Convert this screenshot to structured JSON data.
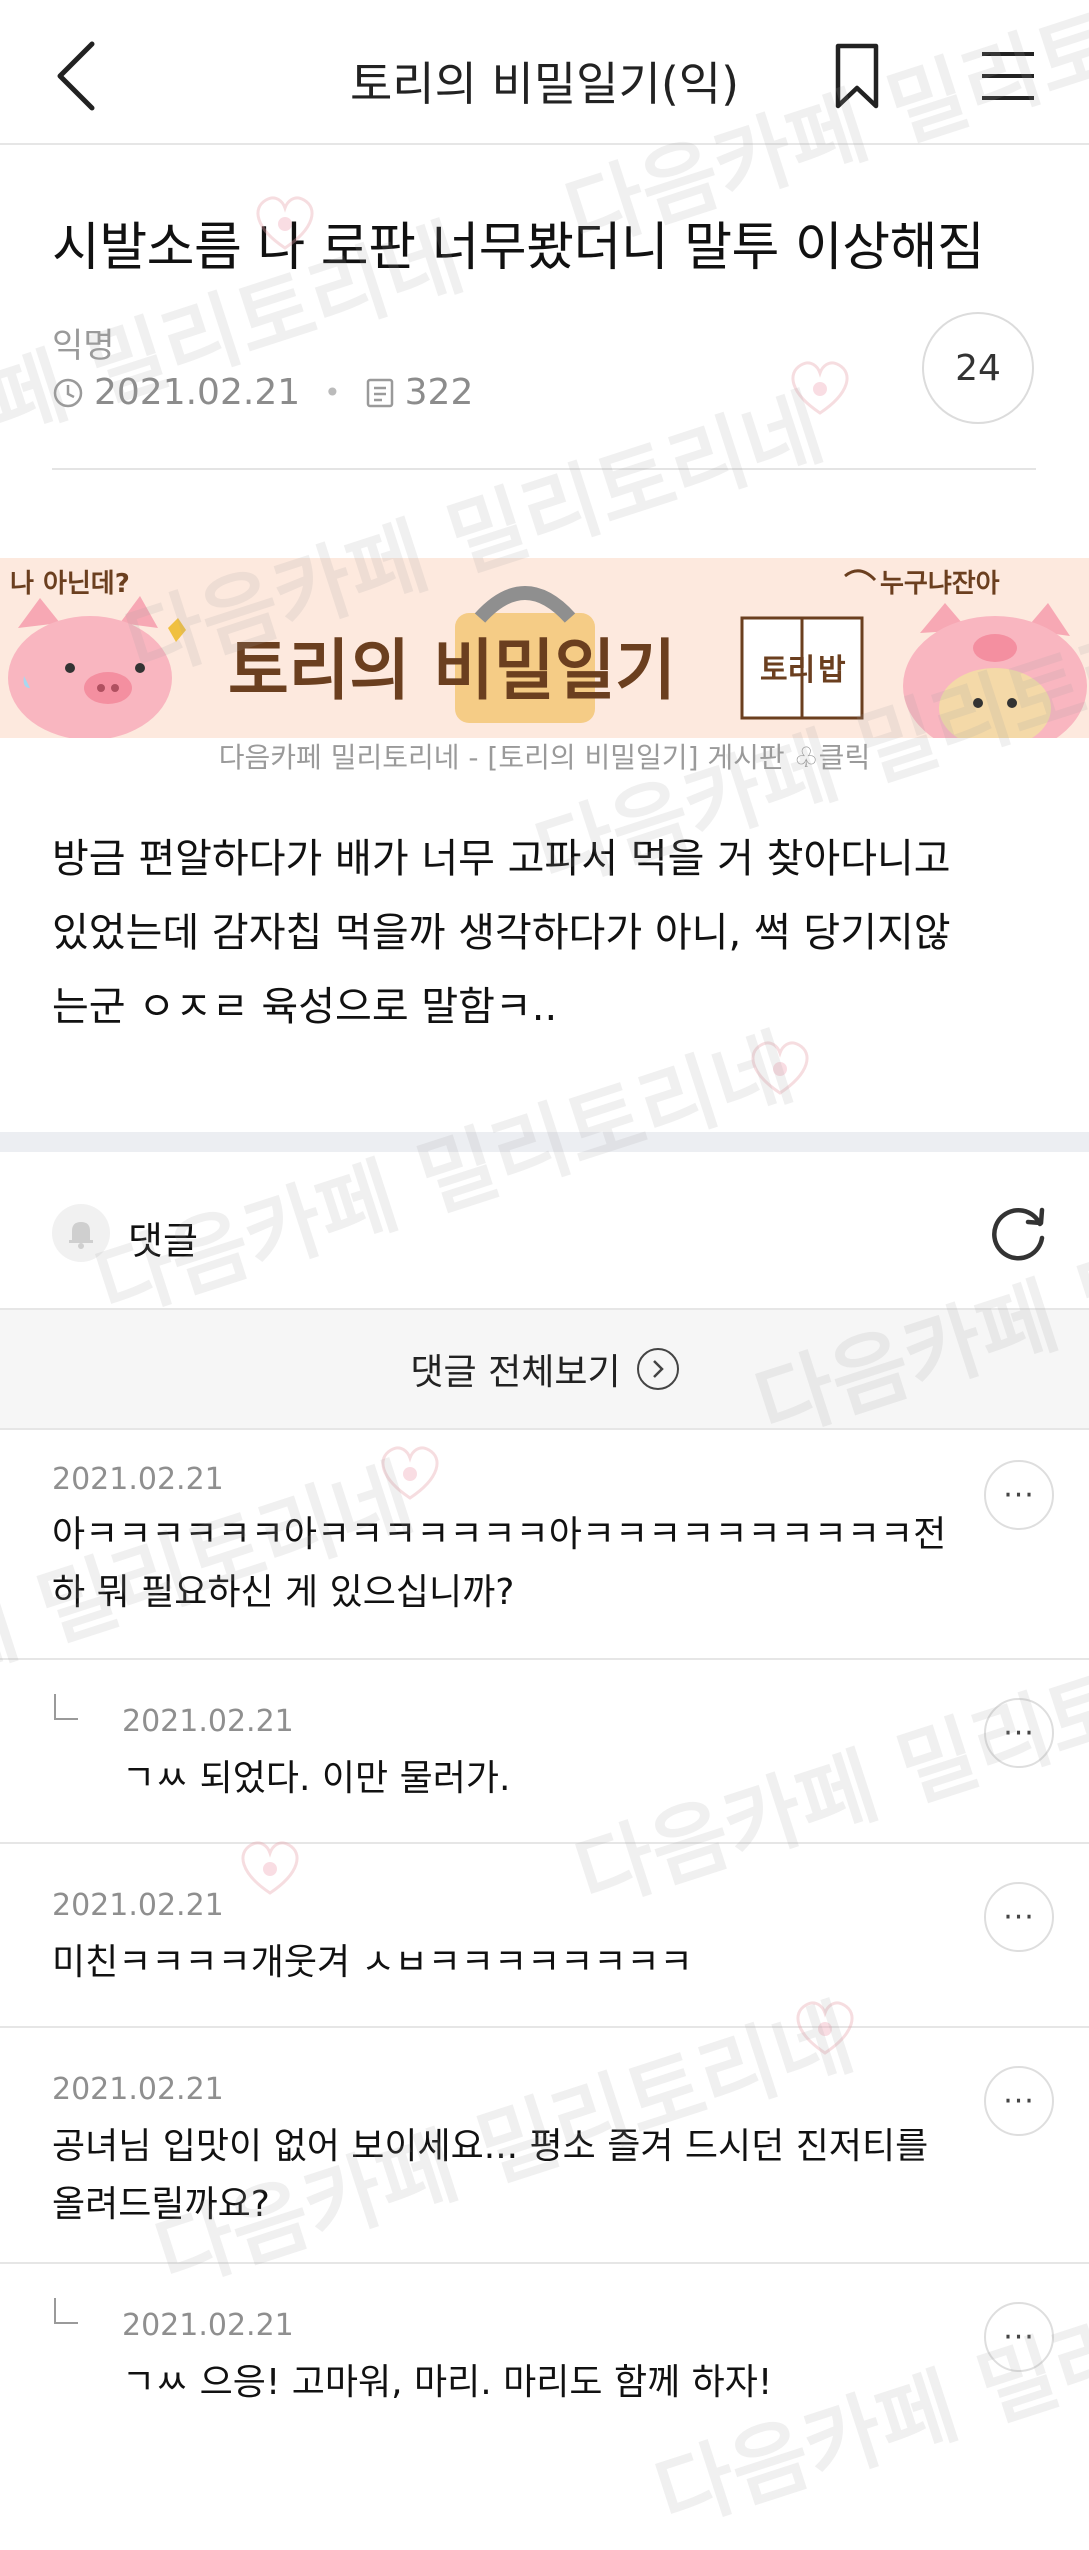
{
  "topbar": {
    "title": "토리의 비밀일기(익)",
    "icons": [
      "chevron-left-icon",
      "bookmark-icon",
      "hamburger-menu-icon"
    ]
  },
  "article": {
    "title": "시발소름 나 로판 너무봤더니 말투 이상해짐",
    "author": "익명",
    "date": "2021.02.21",
    "views": "322",
    "comment_count": "24"
  },
  "banner": {
    "left_tag": "나 아닌데?",
    "title": "토리의 비밀일기",
    "badge": "토리 밥",
    "right_tag": "누구냐잔아",
    "caption": "다음카페 밀리토리네 - [토리의 비밀일기] 게시판 ♧클릭"
  },
  "body": {
    "lines": [
      "방금 편알하다가 배가 너무 고파서 먹을 거 찾아다니고",
      "있었는데 감자칩 먹을까 생각하다가 아니, 썩 당기지않",
      "는군 ㅇㅈㄹ 육성으로 말함ㅋ.."
    ]
  },
  "comments_section": {
    "label": "댓글",
    "view_all": "댓글 전체보기",
    "more_label": "···",
    "items": [
      {
        "date": "2021.02.21",
        "text": "아ㅋㅋㅋㅋㅋㅋ아ㅋㅋㅋㅋㅋㅋㅋ아ㅋㅋㅋㅋㅋㅋㅋㅋㅋㅋ전\n하 뭐 필요하신 게 있으십니까?",
        "reply": false
      },
      {
        "date": "2021.02.21",
        "text": "ㄱㅆ 되었다. 이만 물러가.",
        "reply": true
      },
      {
        "date": "2021.02.21",
        "text": "미친ㅋㅋㅋㅋ개웃겨 ㅅㅂㅋㅋㅋㅋㅋㅋㅋㅋ",
        "reply": false
      },
      {
        "date": "2021.02.21",
        "text": "공녀님 입맛이 없어 보이세요... 평소 즐겨 드시던 진저티를\n올려드릴까요?",
        "reply": false
      },
      {
        "date": "2021.02.21",
        "text": "ㄱㅆ 으응! 고마워, 마리. 마리도 함께 하자!",
        "reply": true
      }
    ]
  },
  "watermark": "다음카페 밀리토리네",
  "colors": {
    "banner_bg": "#fde9de",
    "pig_pink": "#f7a8b4",
    "accent_brown": "#6b3f1f",
    "divider": "#e6e6e6"
  }
}
